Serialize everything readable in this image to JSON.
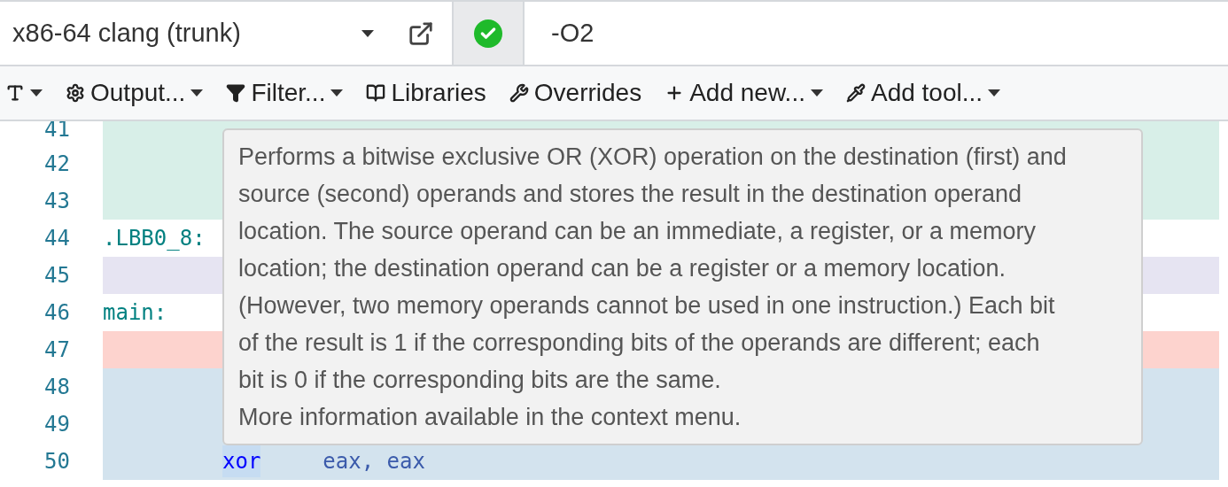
{
  "compiler": {
    "value": "x86-64 clang (trunk)"
  },
  "status": {
    "ok": true
  },
  "options": {
    "value": "-O2"
  },
  "toolbar": [
    {
      "kind": "font",
      "dropdown": true
    },
    {
      "kind": "output",
      "label": "Output...",
      "dropdown": true
    },
    {
      "kind": "filter",
      "label": "Filter...",
      "dropdown": true
    },
    {
      "kind": "libraries",
      "label": "Libraries",
      "dropdown": false
    },
    {
      "kind": "overrides",
      "label": "Overrides",
      "dropdown": false
    },
    {
      "kind": "add",
      "label": "Add new...",
      "dropdown": true
    },
    {
      "kind": "tool",
      "label": "Add tool...",
      "dropdown": true
    }
  ],
  "code": [
    {
      "color": "#d8efe8",
      "lines": [
        {
          "line": "41"
        },
        {
          "line": "42"
        },
        {
          "line": "43"
        }
      ]
    },
    {
      "lines": [
        {
          "line": "44",
          "label": ".LBB0_8:"
        }
      ]
    },
    {
      "color": "#e6e4f2",
      "lines": [
        {
          "line": "45"
        }
      ]
    },
    {
      "lines": [
        {
          "line": "46",
          "label": "main:"
        }
      ]
    },
    {
      "color": "#fdd3ce",
      "lines": [
        {
          "line": "47"
        }
      ]
    },
    {
      "color": "#d3e3ee",
      "lines": [
        {
          "line": "48"
        },
        {
          "line": "49"
        },
        {
          "line": "50",
          "opcode": "xor",
          "operands": "eax, eax",
          "hovered": true
        }
      ]
    }
  ],
  "tooltip": {
    "lines": [
      "Performs a bitwise exclusive OR (XOR) operation on the destination (first) and",
      "source (second) operands and stores the result in the destination operand",
      "location. The source operand can be an immediate, a register, or a memory",
      "location; the destination operand can be a register or a memory location.",
      "(However, two memory operands cannot be used in one instruction.) Each bit",
      "of the result is 1 if the corresponding bits of the operands are different; each",
      "bit is 0 if the corresponding bits are the same.",
      "More information available in the context menu."
    ]
  }
}
